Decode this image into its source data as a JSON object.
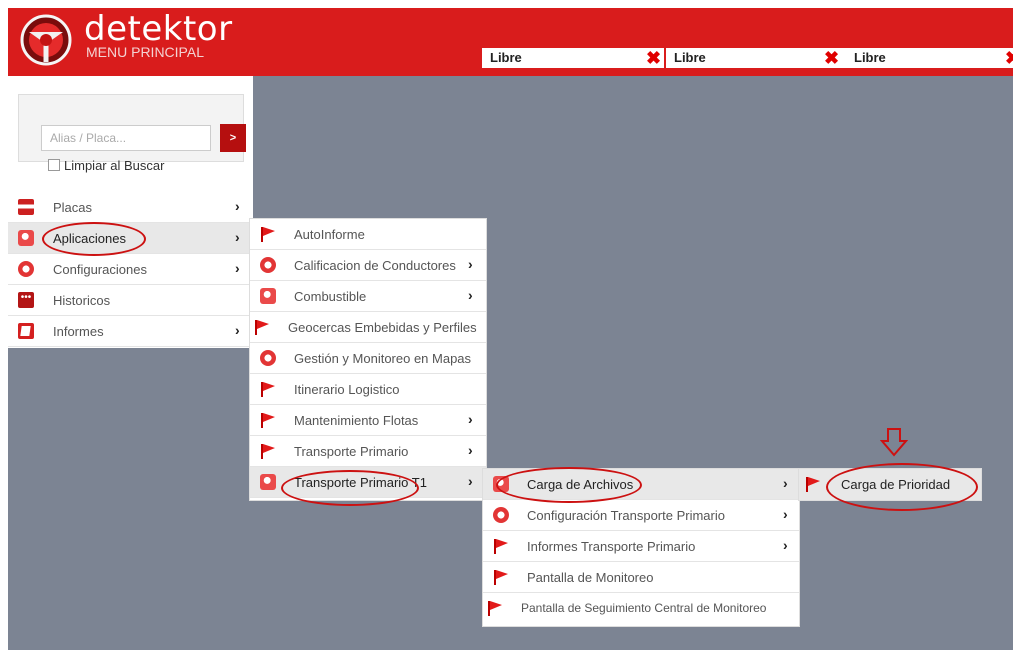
{
  "header": {
    "brand": "detektor",
    "subtitle": "MENU PRINCIPAL"
  },
  "slots": [
    {
      "label": "Libre"
    },
    {
      "label": "Libre"
    },
    {
      "label": "Libre"
    }
  ],
  "search": {
    "placeholder": "Alias / Placa...",
    "button": ">",
    "clear_label": "Limpiar al Buscar"
  },
  "main_menu": [
    {
      "label": "Placas",
      "icon": "plate-icon",
      "arrow": "›"
    },
    {
      "label": "Aplicaciones",
      "icon": "cube-icon",
      "arrow": "›"
    },
    {
      "label": "Configuraciones",
      "icon": "gear-icon",
      "arrow": "›"
    },
    {
      "label": "Historicos",
      "icon": "dots-icon",
      "arrow": ""
    },
    {
      "label": "Informes",
      "icon": "page-icon",
      "arrow": "›"
    }
  ],
  "apps_menu": [
    {
      "label": "AutoInforme",
      "icon": "flag-icon",
      "arrow": ""
    },
    {
      "label": "Calificacion de Conductores",
      "icon": "gear-icon",
      "arrow": "›"
    },
    {
      "label": "Combustible",
      "icon": "cube-icon",
      "arrow": "›"
    },
    {
      "label": "Geocercas Embebidas y Perfiles",
      "icon": "flag-icon",
      "arrow": ""
    },
    {
      "label": "Gestión y Monitoreo en Mapas",
      "icon": "gear-icon",
      "arrow": ""
    },
    {
      "label": "Itinerario Logistico",
      "icon": "flag-icon",
      "arrow": ""
    },
    {
      "label": "Mantenimiento Flotas",
      "icon": "flag-icon",
      "arrow": "›"
    },
    {
      "label": "Transporte Primario",
      "icon": "flag-icon",
      "arrow": "›"
    },
    {
      "label": "Transporte Primario T1",
      "icon": "cube-icon",
      "arrow": "›"
    }
  ],
  "t1_menu": [
    {
      "label": "Carga de Archivos",
      "icon": "cube-icon",
      "arrow": "›"
    },
    {
      "label": "Configuración Transporte Primario",
      "icon": "gear-icon",
      "arrow": "›"
    },
    {
      "label": "Informes Transporte Primario",
      "icon": "flag-icon",
      "arrow": "›"
    },
    {
      "label": "Pantalla de Monitoreo",
      "icon": "flag-icon",
      "arrow": ""
    },
    {
      "label": "Pantalla de Seguimiento Central de Monitoreo",
      "icon": "flag-icon",
      "arrow": ""
    }
  ],
  "carga_menu": [
    {
      "label": "Carga de Prioridad",
      "icon": "flag-icon",
      "arrow": ""
    }
  ],
  "colors": {
    "brand_red": "#d91c1c",
    "background": "#7c8493",
    "highlight": "#e8e8e8",
    "annotation": "#cc1111"
  }
}
